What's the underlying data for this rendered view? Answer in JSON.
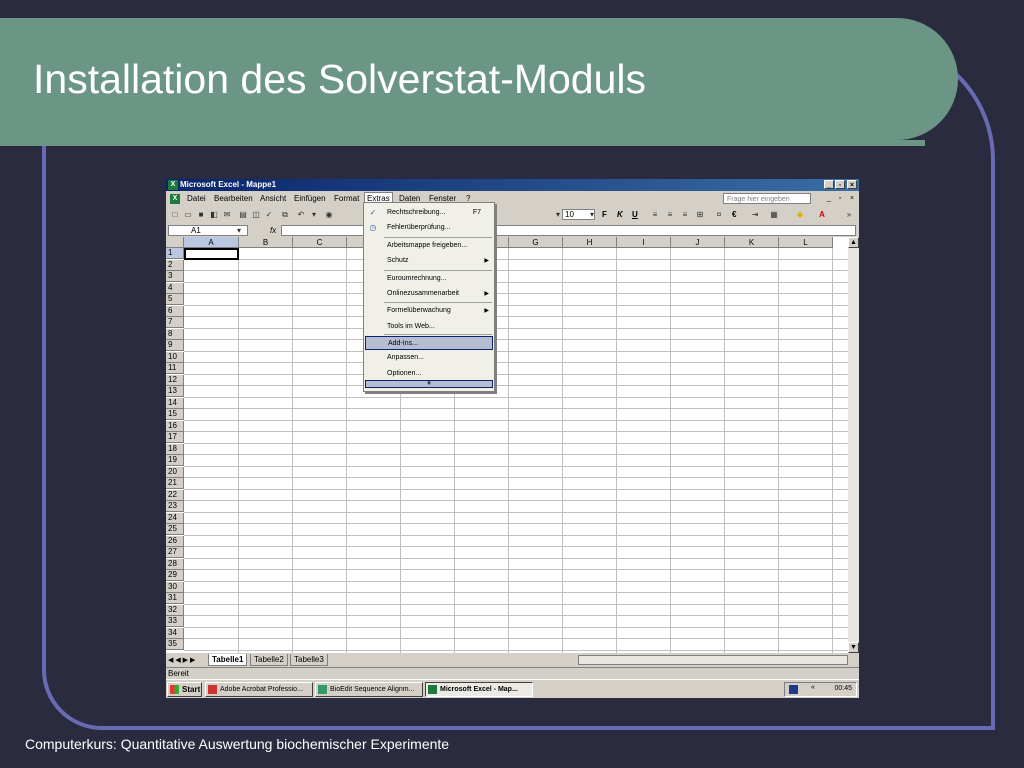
{
  "slide": {
    "title": "Installation des Solverstat-Moduls",
    "footer": "Computerkurs: Quantitative Auswertung biochemischer Experimente"
  },
  "window": {
    "title": "Microsoft Excel - Mappe1",
    "minimize": "_",
    "restore": "▫",
    "close": "×"
  },
  "menubar": {
    "items": [
      "Datei",
      "Bearbeiten",
      "Ansicht",
      "Einfügen",
      "Format",
      "Extras",
      "Daten",
      "Fenster",
      "?"
    ],
    "help_placeholder": "Frage hier eingeben"
  },
  "toolbar": {
    "font_size": "10",
    "bold": "F",
    "italic": "K",
    "underline": "U",
    "euro": "€"
  },
  "formula_bar": {
    "cell_ref": "A1",
    "fx": "fx"
  },
  "grid": {
    "columns": [
      "A",
      "B",
      "C",
      "D",
      "E",
      "F",
      "G",
      "H",
      "I",
      "J",
      "K",
      "L"
    ],
    "rows": [
      "1",
      "2",
      "3",
      "4",
      "5",
      "6",
      "7",
      "8",
      "9",
      "10",
      "11",
      "12",
      "13",
      "14",
      "15",
      "16",
      "17",
      "18",
      "19",
      "20",
      "21",
      "22",
      "23",
      "24",
      "25",
      "26",
      "27",
      "28",
      "29",
      "30",
      "31",
      "32",
      "33",
      "34",
      "35"
    ]
  },
  "extras_menu": {
    "items": [
      {
        "label": "Rechtschreibung...",
        "shortcut": "F7"
      },
      {
        "label": "Fehlerüberprüfung..."
      },
      {
        "label": "Arbeitsmappe freigeben..."
      },
      {
        "label": "Schutz",
        "arrow": "▶"
      },
      {
        "label": "Euroumrechnung..."
      },
      {
        "label": "Onlinezusammenarbeit",
        "arrow": "▶"
      },
      {
        "label": "Formelüberwachung",
        "arrow": "▶"
      },
      {
        "label": "Tools im Web..."
      },
      {
        "label": "Add-Ins..."
      },
      {
        "label": "Anpassen..."
      },
      {
        "label": "Optionen..."
      }
    ],
    "expand": "¥"
  },
  "sheets": {
    "nav": "◀ ◀ ▶ ▶",
    "tabs": [
      "Tabelle1",
      "Tabelle2",
      "Tabelle3"
    ]
  },
  "status": "Bereit",
  "taskbar": {
    "start": "Start",
    "tasks": [
      "Adobe Acrobat Professio...",
      "BioEdit Sequence Alignm...",
      "Microsoft Excel - Map..."
    ],
    "clock": "00:45"
  },
  "colors": {
    "banner": "#6b9686",
    "background": "#2b2b40",
    "frame": "#6a6ab4",
    "titlebar": "#0a246a"
  }
}
